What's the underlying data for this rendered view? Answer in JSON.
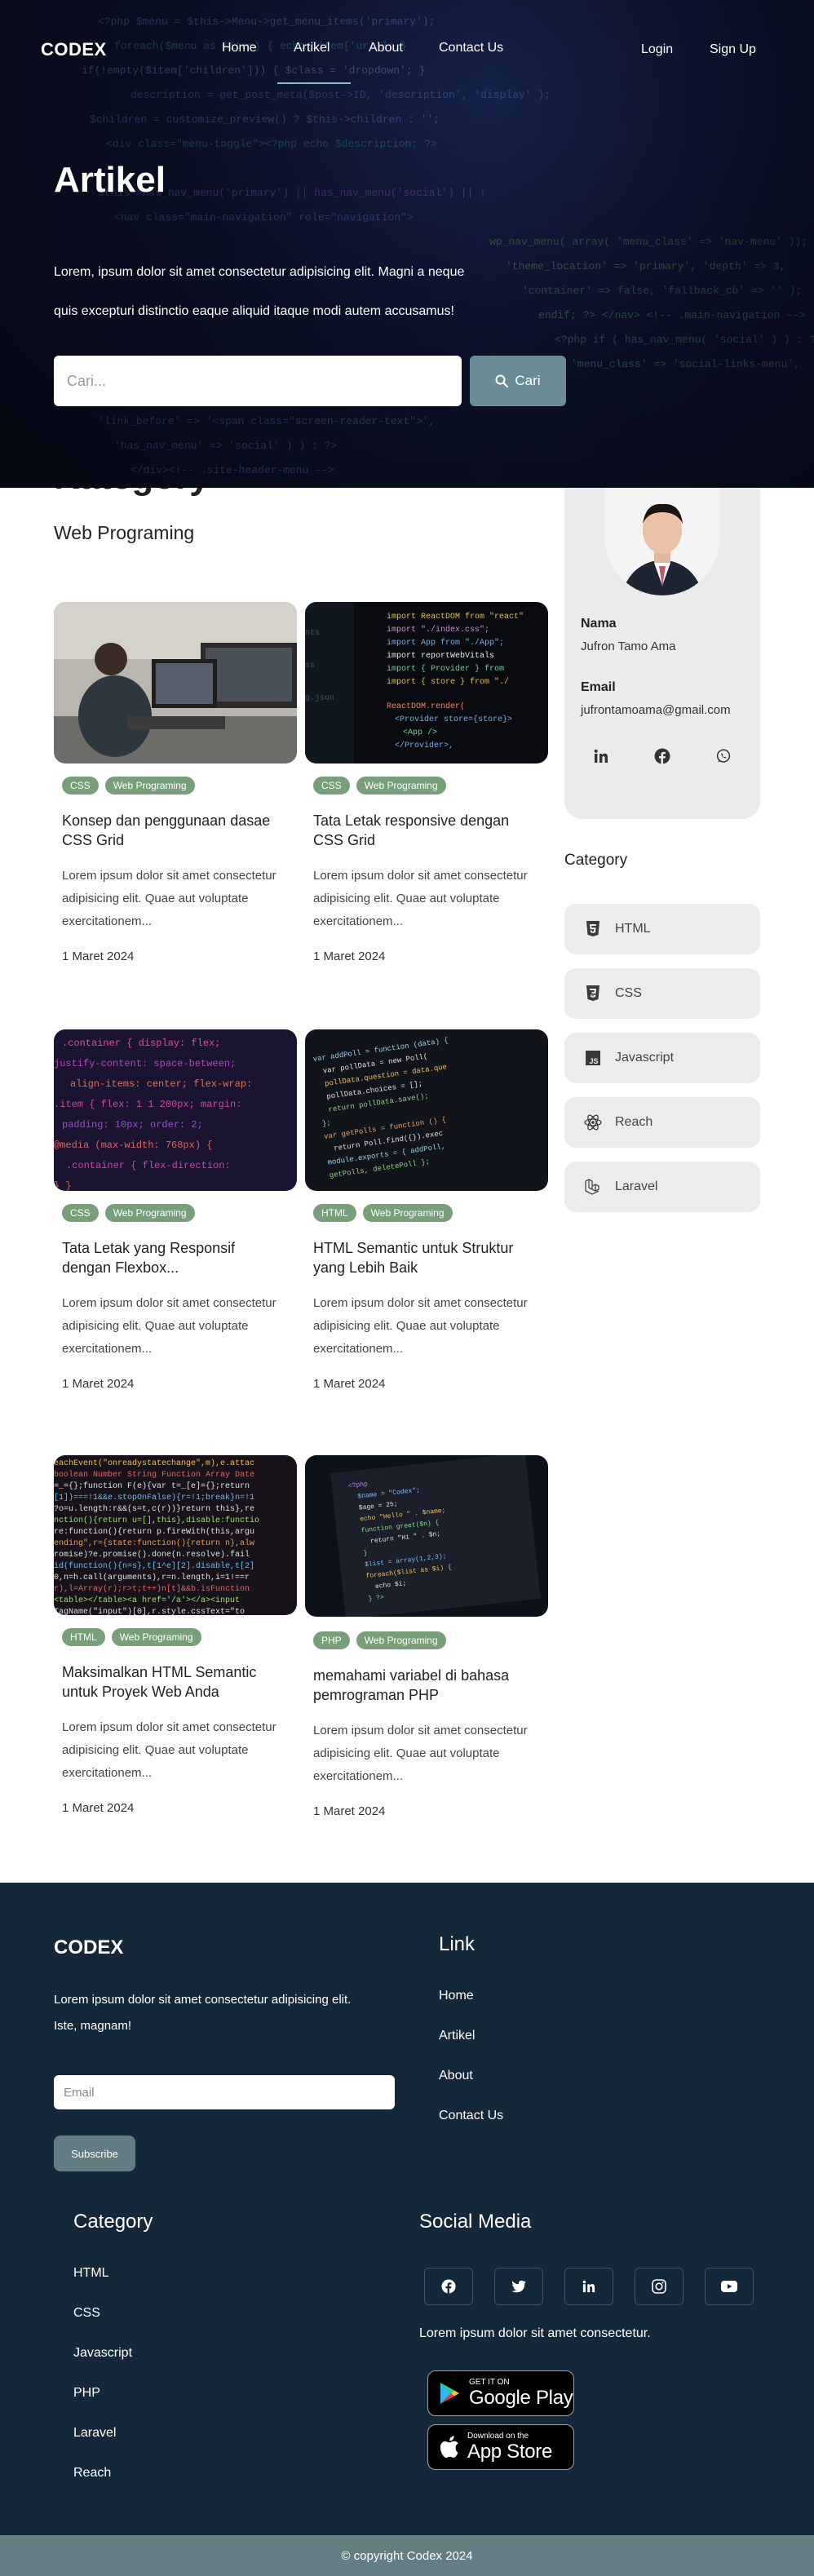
{
  "nav": {
    "brand": "CODEX",
    "links": [
      "Home",
      "Artikel",
      "About",
      "Contact Us"
    ],
    "login": "Login",
    "signup": "Sign Up"
  },
  "hero": {
    "title": "Artikel",
    "desc_line1": "Lorem, ipsum dolor sit amet consectetur adipisicing elit. Magni a neque",
    "desc_line2": "quis excepturi distinctio eaque aliquid itaque modi autem accusamus!",
    "search_placeholder": "Cari...",
    "search_button": "Cari"
  },
  "main": {
    "heading": "Kategory",
    "subheading": "Web Programing"
  },
  "articles": [
    {
      "tags": [
        "CSS",
        "Web Programing"
      ],
      "title": "Konsep dan penggunaan dasae CSS Grid",
      "desc": "Lorem ipsum dolor sit amet consectetur adipisicing elit. Quae aut voluptate exercitationem...",
      "date": "1 Maret 2024"
    },
    {
      "tags": [
        "CSS",
        "Web Programing"
      ],
      "title": "Tata Letak responsive dengan CSS Grid",
      "desc": "Lorem ipsum dolor sit amet consectetur adipisicing elit. Quae aut voluptate exercitationem...",
      "date": "1 Maret 2024"
    },
    {
      "tags": [
        "CSS",
        "Web Programing"
      ],
      "title": "Tata Letak yang Responsif dengan Flexbox...",
      "desc": "Lorem ipsum dolor sit amet consectetur adipisicing elit. Quae aut voluptate exercitationem...",
      "date": "1 Maret 2024"
    },
    {
      "tags": [
        "HTML",
        "Web Programing"
      ],
      "title": "HTML Semantic untuk Struktur yang Lebih Baik",
      "desc": "Lorem ipsum dolor sit amet consectetur adipisicing elit. Quae aut voluptate exercitationem...",
      "date": "1 Maret 2024"
    },
    {
      "tags": [
        "HTML",
        "Web Programing"
      ],
      "title": "Maksimalkan HTML Semantic untuk Proyek Web Anda",
      "desc": "Lorem ipsum dolor sit amet consectetur adipisicing elit. Quae aut voluptate exercitationem...",
      "date": "1 Maret 2024"
    },
    {
      "tags": [
        "PHP",
        "Web Programing"
      ],
      "title": "memahami variabel di bahasa pemrograman PHP",
      "desc": "Lorem ipsum dolor sit amet consectetur adipisicing elit. Quae aut voluptate exercitationem...",
      "date": "1 Maret 2024"
    }
  ],
  "profile": {
    "name_label": "Nama",
    "name": "Jufron Tamo Ama",
    "email_label": "Email",
    "email": "jufrontamoama@gmail.com",
    "socials": [
      "linkedin-icon",
      "facebook-icon",
      "whatsapp-icon"
    ]
  },
  "categories": {
    "heading": "Category",
    "items": [
      {
        "label": "HTML",
        "icon": "html5-icon"
      },
      {
        "label": "CSS",
        "icon": "css3-icon"
      },
      {
        "label": "Javascript",
        "icon": "javascript-icon"
      },
      {
        "label": "Reach",
        "icon": "react-icon"
      },
      {
        "label": "Laravel",
        "icon": "laravel-icon"
      }
    ]
  },
  "footer": {
    "brand": "CODEX",
    "desc_line1": "Lorem ipsum dolor sit amet consectetur adipisicing elit.",
    "desc_line2": "Iste, magnam!",
    "email_placeholder": "Email",
    "subscribe": "Subscribe",
    "link_heading": "Link",
    "links": [
      "Home",
      "Artikel",
      "About",
      "Contact Us"
    ],
    "category_heading": "Category",
    "categories": [
      "HTML",
      "CSS",
      "Javascript",
      "PHP",
      "Laravel",
      "Reach"
    ],
    "social_heading": "Social Media",
    "social_icons": [
      "facebook-icon",
      "twitter-icon",
      "linkedin-icon",
      "instagram-icon",
      "youtube-icon"
    ],
    "social_text": "Lorem ipsum dolor sit amet consectetur.",
    "google_play_small": "GET IT ON",
    "google_play_big": "Google Play",
    "app_store_small": "Download on the",
    "app_store_big": "App Store",
    "copyright": "© copyright Codex 2024"
  },
  "colors": {
    "tag": "#789f7a",
    "footer_bg": "#15283a",
    "button": "#6a8c94",
    "copyright_bg": "#657e84"
  }
}
